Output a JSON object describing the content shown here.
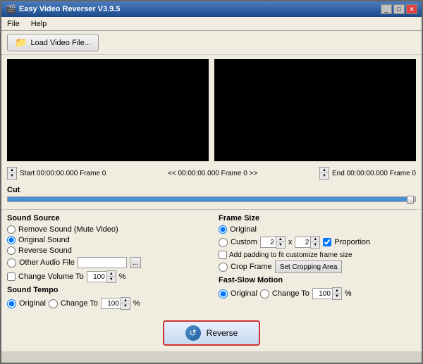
{
  "window": {
    "title": "Easy Video Reverser V3.9.5",
    "title_icon": "video-icon",
    "controls": [
      "minimize",
      "maximize",
      "close"
    ]
  },
  "menu": {
    "items": [
      {
        "label": "File",
        "id": "file"
      },
      {
        "label": "Help",
        "id": "help"
      }
    ]
  },
  "toolbar": {
    "load_button_label": "Load Video File..."
  },
  "timeline": {
    "start_label": "Start 00:00:00.000 Frame 0",
    "middle_label": "<< 00:00:00.000  Frame 0 >>",
    "end_label": "End 00:00:00.000 Frame 0"
  },
  "cut_label": "Cut",
  "sound_source": {
    "title": "Sound Source",
    "options": [
      {
        "label": "Remove Sound (Mute Video)",
        "value": "mute",
        "selected": false
      },
      {
        "label": "Original Sound",
        "value": "original",
        "selected": true
      },
      {
        "label": "Reverse Sound",
        "value": "reverse",
        "selected": false
      },
      {
        "label": "Other Audio File",
        "value": "other",
        "selected": false
      }
    ],
    "audio_file_placeholder": "",
    "browse_btn": "...",
    "change_volume_label": "Change Volume To",
    "volume_value": "100",
    "volume_unit": "%"
  },
  "sound_tempo": {
    "title": "Sound Tempo",
    "original_label": "Original",
    "change_to_label": "Change To",
    "tempo_value": "100",
    "tempo_unit": "%"
  },
  "frame_size": {
    "title": "Frame Size",
    "options": [
      {
        "label": "Original",
        "value": "original",
        "selected": true
      },
      {
        "label": "Custom",
        "value": "custom",
        "selected": false
      },
      {
        "label": "Crop Frame",
        "value": "crop",
        "selected": false
      }
    ],
    "custom_w": "2",
    "custom_x": "x",
    "custom_h": "2",
    "proportion_label": "Proportion",
    "proportion_checked": true,
    "padding_label": "Add padding to fit customize frame size",
    "padding_checked": false,
    "set_crop_label": "Set Cropping Area"
  },
  "fast_slow_motion": {
    "title": "Fast-Slow Motion",
    "original_label": "Original",
    "change_to_label": "Change To",
    "motion_value": "100",
    "motion_unit": "%"
  },
  "reverse_button": {
    "label": "Reverse",
    "icon": "reverse-icon"
  }
}
